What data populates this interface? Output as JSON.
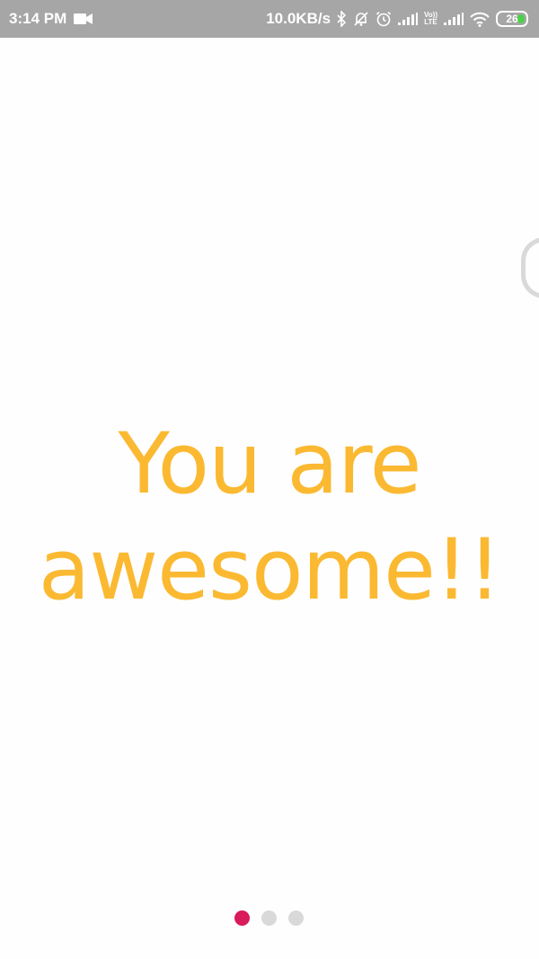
{
  "status_bar": {
    "time": "3:14 PM",
    "network_speed": "10.0KB/s",
    "volte_top": "Vo))",
    "volte_bottom": "LTE",
    "battery_level": "26",
    "icons": [
      "video-camera-icon",
      "bluetooth-icon",
      "bell-muted-icon",
      "alarm-icon",
      "signal-icon",
      "volte-icon",
      "signal-icon",
      "wifi-icon",
      "battery-icon"
    ]
  },
  "main": {
    "line1": "You are",
    "line2": "awesome!!"
  },
  "pager": {
    "pages": 3,
    "active_index": 0
  },
  "colors": {
    "status_bar": "#a6a6a6",
    "message_text": "#fbb932",
    "dot_active": "#d81b5a",
    "dot_inactive": "#d9d9d9",
    "battery_fill": "#4cd14a"
  }
}
